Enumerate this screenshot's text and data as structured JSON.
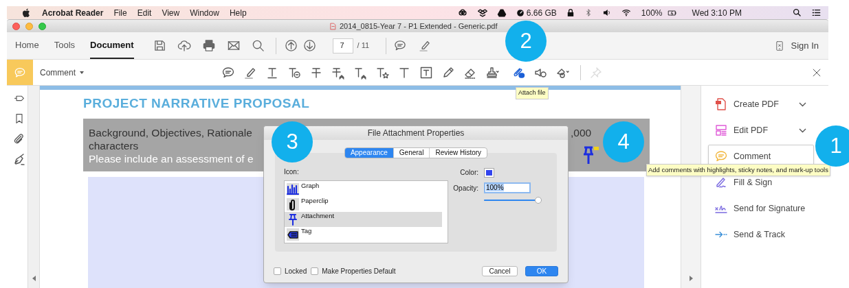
{
  "menu_bar": {
    "app_name": "Acrobat Reader",
    "items": [
      "File",
      "Edit",
      "View",
      "Window",
      "Help"
    ],
    "storage": "6.66 GB",
    "battery": "100%",
    "clock": "Wed 3:10 PM"
  },
  "window": {
    "title": "2014_0815-Year 7 - P1 Extended - Generic.pdf"
  },
  "toolbar": {
    "tabs": [
      {
        "label": "Home",
        "selected": false
      },
      {
        "label": "Tools",
        "selected": false
      },
      {
        "label": "Document",
        "selected": true
      }
    ],
    "page_number": "7",
    "page_total": "/ 11",
    "sign_in": "Sign In"
  },
  "comment_toolbar": {
    "label": "Comment",
    "tools": [
      {
        "kind": "sticky-note",
        "selected": false,
        "disabled": false
      },
      {
        "kind": "highlight",
        "selected": false,
        "disabled": false
      },
      {
        "kind": "underline",
        "selected": false,
        "disabled": false
      },
      {
        "kind": "text-comment",
        "selected": false,
        "disabled": false
      },
      {
        "kind": "strikethrough",
        "selected": false,
        "disabled": false
      },
      {
        "kind": "replace",
        "selected": false,
        "disabled": false
      },
      {
        "kind": "insert",
        "selected": false,
        "disabled": false
      },
      {
        "kind": "add-note",
        "selected": false,
        "disabled": false
      },
      {
        "kind": "text",
        "selected": false,
        "disabled": false
      },
      {
        "kind": "text-box",
        "selected": false,
        "disabled": false
      },
      {
        "kind": "pencil",
        "selected": false,
        "disabled": false
      },
      {
        "kind": "eraser",
        "selected": false,
        "disabled": false
      },
      {
        "kind": "stamp",
        "selected": false,
        "disabled": false
      },
      {
        "kind": "attach",
        "selected": true,
        "disabled": false
      },
      {
        "kind": "sound",
        "selected": false,
        "disabled": false
      },
      {
        "kind": "shapes",
        "selected": false,
        "disabled": false
      },
      {
        "kind": "pin",
        "selected": false,
        "disabled": true
      }
    ],
    "tooltip": "Attach file"
  },
  "document": {
    "title": "PROJECT NARRATIVE PROPOSAL",
    "heading_line_1": "Background, Objectives, Rationale",
    "heading_line_1_end": ",000",
    "heading_line_2": "characters",
    "instruction_line": "Please include an assessment of e"
  },
  "dialog": {
    "title": "File Attachment Properties",
    "tabs": [
      {
        "label": "Appearance",
        "selected": true
      },
      {
        "label": "General",
        "selected": false
      },
      {
        "label": "Review History",
        "selected": false
      }
    ],
    "icon_label": "Icon:",
    "icons": [
      {
        "kind": "graph",
        "label": "Graph",
        "selected": false
      },
      {
        "kind": "paperclip",
        "label": "Paperclip",
        "selected": false
      },
      {
        "kind": "attachment",
        "label": "Attachment",
        "selected": true
      },
      {
        "kind": "tag",
        "label": "Tag",
        "selected": false
      }
    ],
    "color_label": "Color:",
    "opacity_label": "Opacity:",
    "opacity_value": "100%",
    "opacity_slider": {
      "level": 1.0
    },
    "checkboxes": [
      {
        "label": "Locked",
        "checked": false
      },
      {
        "label": "Make Properties Default",
        "checked": false
      }
    ],
    "buttons": [
      {
        "label": "Cancel",
        "kind": "secondary"
      },
      {
        "label": "OK",
        "kind": "primary"
      }
    ]
  },
  "right_panel": {
    "items": [
      {
        "kind": "create-pdf",
        "label": "Create PDF",
        "expandable": true,
        "selected": false
      },
      {
        "kind": "edit-pdf",
        "label": "Edit PDF",
        "expandable": true,
        "selected": false
      },
      {
        "kind": "comment",
        "label": "Comment",
        "expandable": false,
        "selected": true
      },
      {
        "kind": "fill-sign",
        "label": "Fill & Sign",
        "expandable": false,
        "selected": false
      },
      {
        "kind": "send-signature",
        "label": "Send for Signature",
        "expandable": false,
        "selected": false
      },
      {
        "kind": "send-track",
        "label": "Send & Track",
        "expandable": false,
        "selected": false
      }
    ],
    "tooltip": "Add comments with highlights, sticky notes, and mark-up tools"
  },
  "callouts": [
    "1",
    "2",
    "3",
    "4"
  ]
}
